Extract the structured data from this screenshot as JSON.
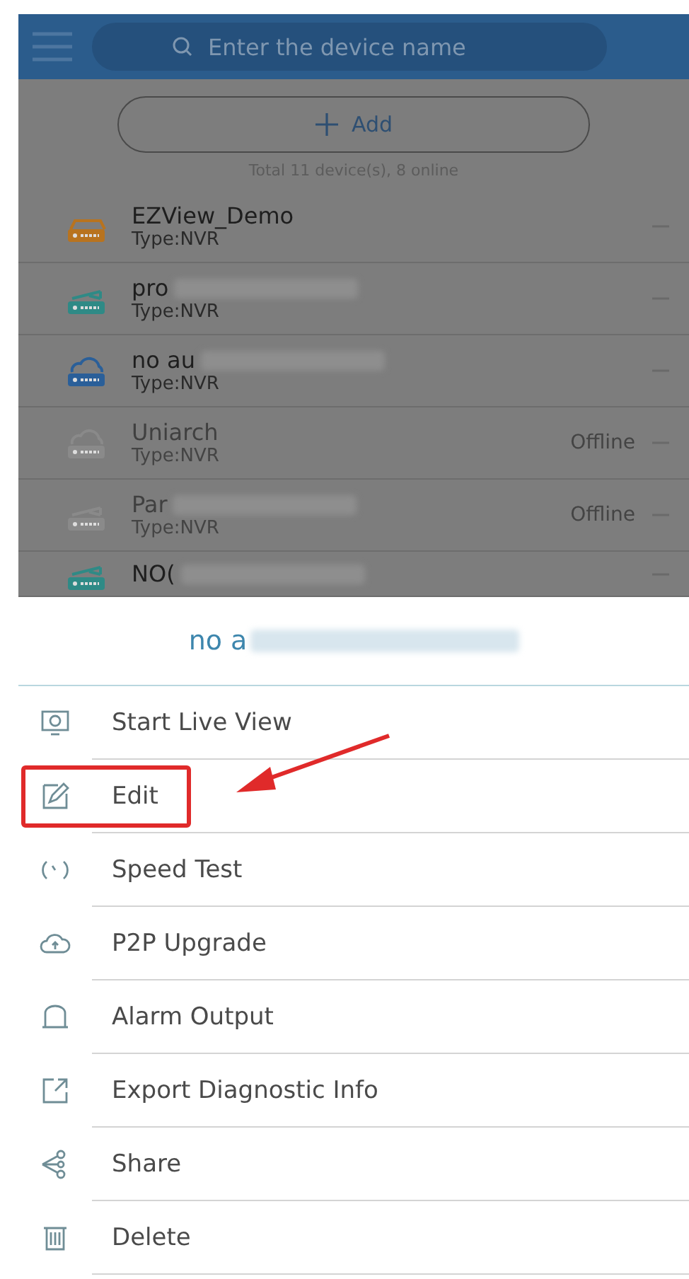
{
  "header": {
    "search": {
      "placeholder": "Enter the device name"
    }
  },
  "add_button": {
    "label": "Add"
  },
  "summary": "Total 11 device(s), 8 online",
  "devices": [
    {
      "name": "EZView_Demo",
      "type": "Type:NVR",
      "color": "#b8731f",
      "kind": "recorder",
      "offline": false,
      "redacted": false
    },
    {
      "name": "pro",
      "type": "Type:NVR",
      "color": "#2f8a86",
      "kind": "shared",
      "offline": false,
      "redacted": true
    },
    {
      "name": "no au",
      "type": "Type:NVR",
      "color": "#2a5f99",
      "kind": "cloud",
      "offline": false,
      "redacted": true
    },
    {
      "name": "Uniarch",
      "type": "Type:NVR",
      "color": "#8a8a8a",
      "kind": "cloud",
      "offline": true,
      "status": "Offline",
      "redacted": false
    },
    {
      "name": "Par",
      "type": "Type:NVR",
      "color": "#8a8a8a",
      "kind": "shared",
      "offline": true,
      "status": "Offline",
      "redacted": true
    },
    {
      "name": "NO(",
      "color": "#2f8a86",
      "kind": "shared",
      "offline": false,
      "redacted": true
    }
  ],
  "sheet": {
    "title": "no a",
    "redacted": true,
    "items": [
      {
        "label": "Start Live View",
        "kind": "live",
        "highlighted": false
      },
      {
        "label": "Edit",
        "kind": "edit",
        "highlighted": true
      },
      {
        "label": "Speed Test",
        "kind": "speed",
        "highlighted": false
      },
      {
        "label": "P2P Upgrade",
        "kind": "upgrade",
        "highlighted": false
      },
      {
        "label": "Alarm Output",
        "kind": "alarm",
        "highlighted": false
      },
      {
        "label": "Export Diagnostic Info",
        "kind": "export",
        "highlighted": false
      },
      {
        "label": "Share",
        "kind": "share",
        "highlighted": false
      },
      {
        "label": "Delete",
        "kind": "delete",
        "highlighted": false
      }
    ]
  }
}
